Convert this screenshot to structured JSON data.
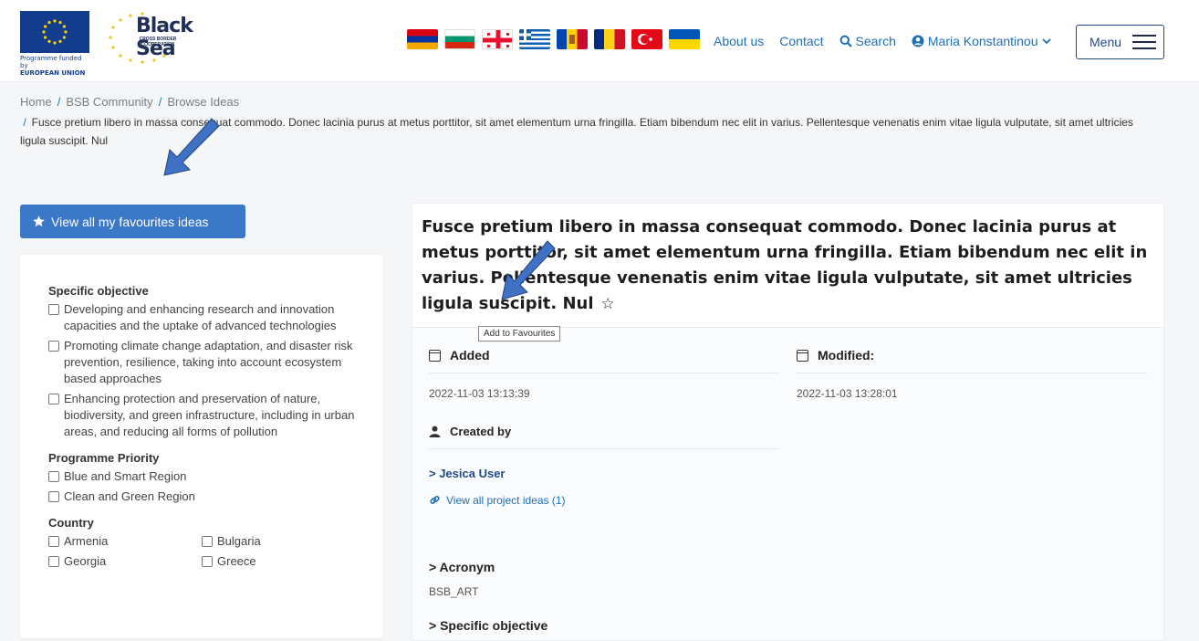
{
  "header": {
    "eu_caption_line1": "Programme funded by",
    "eu_caption_line2": "EUROPEAN UNION",
    "brand_title": "Black Sea",
    "brand_sub": "CROSS BORDER COOPERATION",
    "nav": {
      "about": "About us",
      "contact": "Contact",
      "search": "Search",
      "user": "Maria Konstantinou"
    },
    "menu_label": "Menu"
  },
  "flags": [
    "Armenia",
    "Bulgaria",
    "Georgia",
    "Greece",
    "Moldova",
    "Romania",
    "Turkey",
    "Ukraine"
  ],
  "breadcrumb": {
    "items": [
      "Home",
      "BSB Community",
      "Browse Ideas"
    ],
    "current": "Fusce pretium libero in massa consequat commodo. Donec lacinia purus at metus porttitor, sit amet elementum urna fringilla. Etiam bibendum nec elit in varius. Pellentesque venenatis enim vitae ligula vulputate, sit amet ultricies ligula suscipit. Nul"
  },
  "favourites_button": "View all my favourites ideas",
  "filters": {
    "specific_objective": {
      "title": "Specific objective",
      "options": [
        "Developing and enhancing research and innovation capacities and the uptake of advanced technologies",
        "Promoting climate change adaptation, and disaster risk prevention, resilience, taking into account ecosystem based approaches",
        "Enhancing protection and preservation of nature, biodiversity, and green infrastructure, including in urban areas, and reducing all forms of pollution"
      ]
    },
    "programme_priority": {
      "title": "Programme Priority",
      "options": [
        "Blue and Smart Region",
        "Clean and Green Region"
      ]
    },
    "country": {
      "title": "Country",
      "options": [
        "Armenia",
        "Bulgaria",
        "Georgia",
        "Greece"
      ]
    }
  },
  "detail": {
    "title": "Fusce pretium libero in massa consequat commodo. Donec lacinia purus at metus porttitor, sit amet elementum urna fringilla. Etiam bibendum nec elit in varius. Pellentesque venenatis enim vitae ligula vulputate, sit amet ultricies ligula suscipit. Nul",
    "tooltip": "Add to Favourites",
    "added_label": "Added",
    "added_value": "2022-11-03 13:13:39",
    "modified_label": "Modified:",
    "modified_value": "2022-11-03 13:28:01",
    "created_by_label": "Created by",
    "creator": "> Jesica User",
    "view_all_projects": "View all project ideas (1)",
    "acronym_label": "> Acronym",
    "acronym_value": "BSB_ART",
    "specific_objective_label": "> Specific objective"
  },
  "colors": {
    "primary_button": "#3c78c8",
    "link": "#1f6fb8",
    "annotation_arrow": "#3f72c4"
  }
}
